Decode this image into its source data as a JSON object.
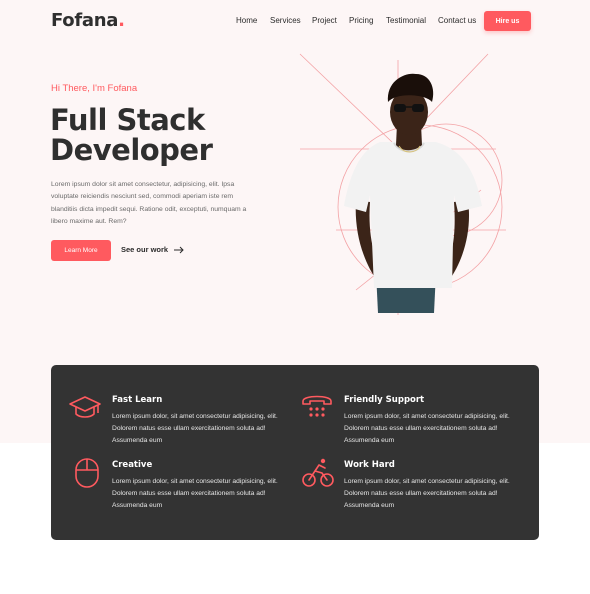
{
  "header": {
    "logo": "Fofana",
    "logo_dot": ".",
    "nav": [
      "Home",
      "Services",
      "Project",
      "Pricing",
      "Testimonial",
      "Contact us"
    ],
    "cta": "Hire us"
  },
  "hero": {
    "greeting": "Hi There, I'm Fofana",
    "headline_line1": "Full Stack",
    "headline_line2": "Developer",
    "intro": "Lorem ipsum dolor sit amet consectetur, adipisicing, elit. Ipsa voluptate reiciendis nesciunt sed, commodi aperiam iste rem blanditiis dicta impedit sequi. Ratione odit, exceptuti, numquam a libero maxime aut. Rem?",
    "primary_button": "Learn More",
    "secondary_link": "See our work"
  },
  "features": [
    {
      "title": "Fast Learn",
      "icon": "graduation-cap-icon",
      "text": "Lorem ipsum dolor, sit amet consectetur adipisicing, elit. Dolorem natus esse ullam exercitationem soluta ad! Assumenda eum"
    },
    {
      "title": "Friendly Support",
      "icon": "telephone-icon",
      "text": "Lorem ipsum dolor, sit amet consectetur adipisicing, elit. Dolorem natus esse ullam exercitationem soluta ad! Assumenda eum"
    },
    {
      "title": "Creative",
      "icon": "mouse-icon",
      "text": "Lorem ipsum dolor, sit amet consectetur adipisicing, elit. Dolorem natus esse ullam exercitationem soluta ad! Assumenda eum"
    },
    {
      "title": "Work Hard",
      "icon": "cyclist-icon",
      "text": "Lorem ipsum dolor, sit amet consectetur adipisicing, elit. Dolorem natus esse ullam exercitationem soluta ad! Assumenda eum"
    }
  ],
  "colors": {
    "accent": "#ff5a5f",
    "dark": "#333333",
    "hero_bg": "#fdf6f6"
  }
}
